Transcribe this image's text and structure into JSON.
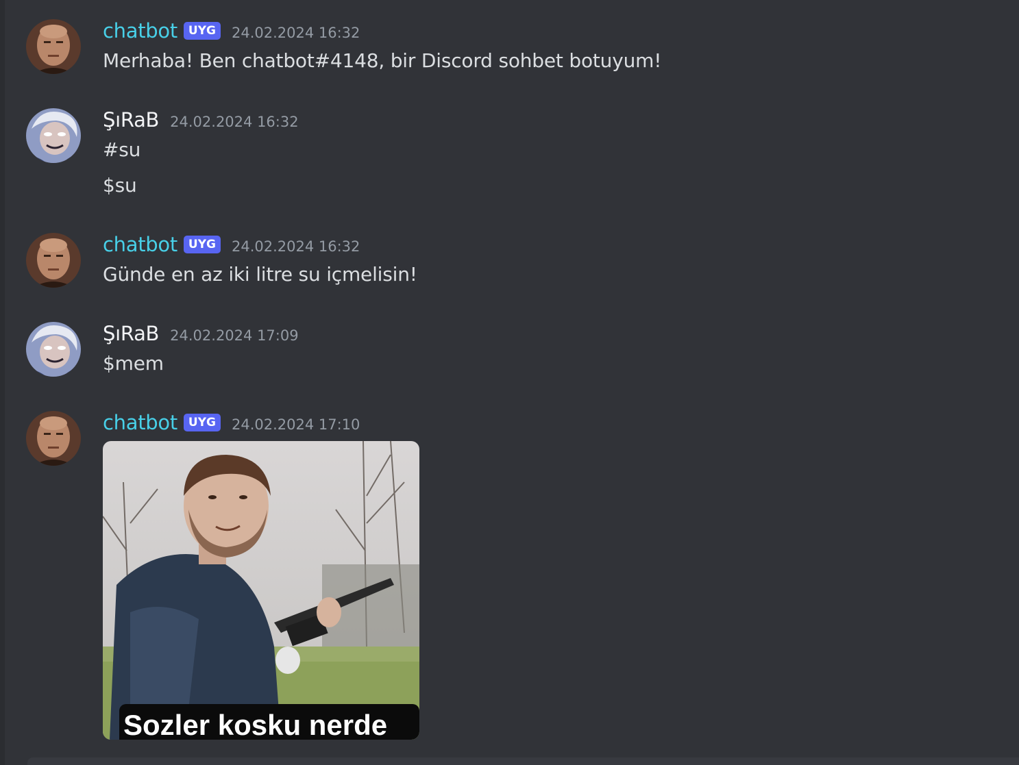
{
  "messages": [
    {
      "author": "chatbot",
      "badge": "UYG",
      "timestamp": "24.02.2024 16:32",
      "lines": [
        "Merhaba! Ben chatbot#4148, bir Discord sohbet botuyum!"
      ]
    },
    {
      "author": "ŞıRaB",
      "timestamp": "24.02.2024 16:32",
      "lines": [
        "#su",
        "$su"
      ]
    },
    {
      "author": "chatbot",
      "badge": "UYG",
      "timestamp": "24.02.2024 16:32",
      "lines": [
        "Günde en az iki litre su içmelisin!"
      ]
    },
    {
      "author": "ŞıRaB",
      "timestamp": "24.02.2024 17:09",
      "lines": [
        "$mem"
      ]
    },
    {
      "author": "chatbot",
      "badge": "UYG",
      "timestamp": "24.02.2024 17:10",
      "attachment": {
        "type": "image",
        "caption": "Sozler kosku nerde"
      }
    }
  ],
  "colors": {
    "background": "#313338",
    "bot_username": "#48d0e8",
    "user_username": "#f2f3f5",
    "badge": "#5865f2",
    "timestamp": "#949ba4",
    "message_text": "#dbdee1"
  },
  "icons": {
    "bot_avatar": "bald-man-avatar-icon",
    "user_avatar": "anime-character-avatar-icon"
  }
}
